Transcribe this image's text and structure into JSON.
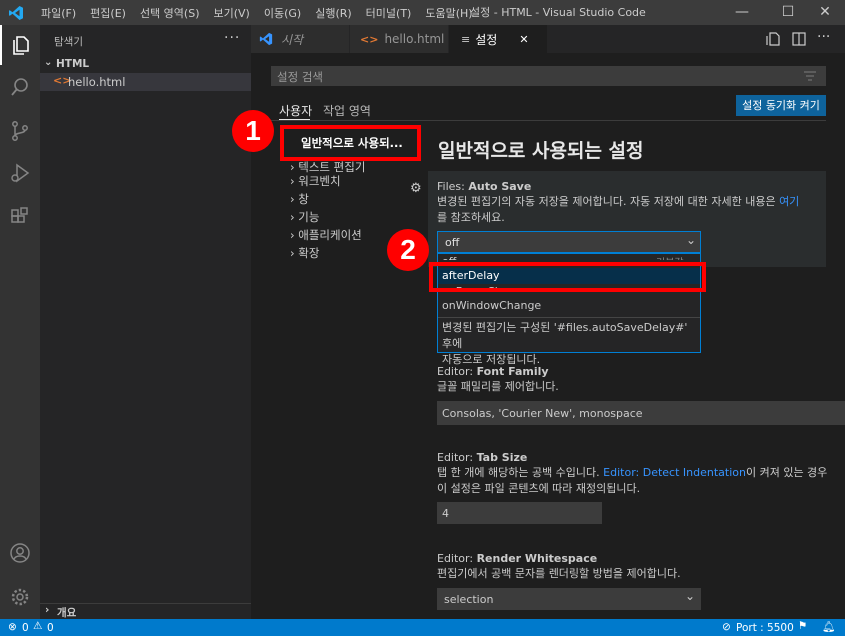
{
  "titlebar": {
    "menu": [
      "파일(F)",
      "편집(E)",
      "선택 영역(S)",
      "보기(V)",
      "이동(G)",
      "실행(R)",
      "터미널(T)",
      "도움말(H)"
    ],
    "window_title": "설정 - HTML - Visual Studio Code",
    "minimize": "—",
    "maximize": "☐",
    "close": "✕"
  },
  "activity": {
    "icons": [
      "explorer-icon",
      "search-icon",
      "source-control-icon",
      "run-debug-icon",
      "extensions-icon",
      "account-icon",
      "manage-gear-icon"
    ]
  },
  "sidebar": {
    "title": "탐색기",
    "more": "···",
    "folder": "HTML",
    "file": "hello.html",
    "outline": "개요"
  },
  "tabs": [
    {
      "label": "시작",
      "icon": "vscode-icon"
    },
    {
      "label": "hello.html",
      "icon": "html-file-icon"
    },
    {
      "label": "설정",
      "icon": "settings-file-icon",
      "close": "✕"
    }
  ],
  "settings": {
    "search_placeholder": "설정 검색",
    "scope_user": "사용자",
    "scope_workspace": "작업 영역",
    "sync_button": "설정 동기화 켜기",
    "toc": [
      "일반적으로 사용되...",
      "텍스트 편집기",
      "워크벤치",
      "창",
      "기능",
      "애플리케이션",
      "확장"
    ],
    "section_title": "일반적으로 사용되는 설정",
    "autosave": {
      "title_prefix": "Files: ",
      "title": "Auto Save",
      "desc1": "변경된 편집기의 자동 저장을 제어합니다. 자동 저장에 대한 자세한 내용은 ",
      "link": "여기",
      "desc2": "를 참조하세요.",
      "value": "off",
      "options": [
        "off",
        "afterDelay",
        "onFocusChange",
        "onWindowChange"
      ],
      "option_hint": "기본값",
      "option_desc1": "변경된 편집기는 구성된 '#files.autoSaveDelay#' 후에",
      "option_desc2": "자동으로 저장됩니다."
    },
    "fontfamily": {
      "title_prefix": "Editor: ",
      "title": "Font Family",
      "desc": "글꼴 패밀리를 제어합니다.",
      "value": "Consolas, 'Courier New', monospace"
    },
    "tabsize": {
      "title_prefix": "Editor: ",
      "title": "Tab Size",
      "desc1": "탭 한 개에 해당하는 공백 수입니다. ",
      "link": "Editor: Detect Indentation",
      "desc1b": "이 켜져 있는 경우",
      "desc2": "이 설정은 파일 콘텐츠에 따라 재정의됩니다.",
      "value": "4"
    },
    "whitespace": {
      "title_prefix": "Editor: ",
      "title": "Render Whitespace",
      "desc": "편집기에서 공백 문자를 렌더링할 방법을 제어합니다.",
      "value": "selection"
    }
  },
  "annotations": {
    "badge1": "1",
    "badge2": "2"
  },
  "statusbar": {
    "errors": "0",
    "warnings": "0",
    "port": "Port : 5500"
  }
}
